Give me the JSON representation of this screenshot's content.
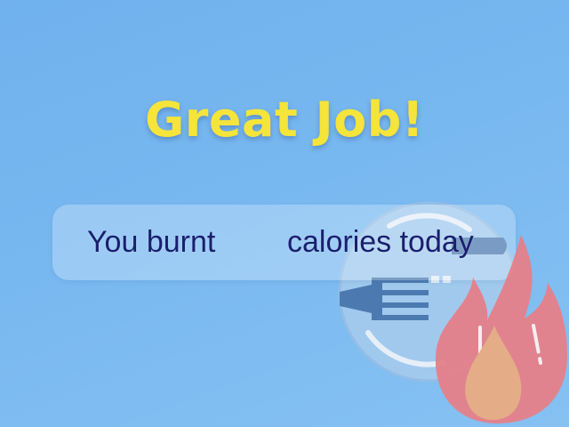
{
  "headline": "Great Job!",
  "message": {
    "prefix": "You burnt",
    "calories_value": "",
    "suffix": "calories today"
  },
  "icons": {
    "plate": "plate-with-fork-icon",
    "flame": "flame-icon"
  },
  "colors": {
    "background": "#78b8f0",
    "headline": "#f5e43a",
    "message_text": "#1a1f6e",
    "flame_outer": "#e58089",
    "flame_inner": "#e4ad87",
    "plate": "#a8cdee",
    "fork": "#4d7cb0"
  }
}
